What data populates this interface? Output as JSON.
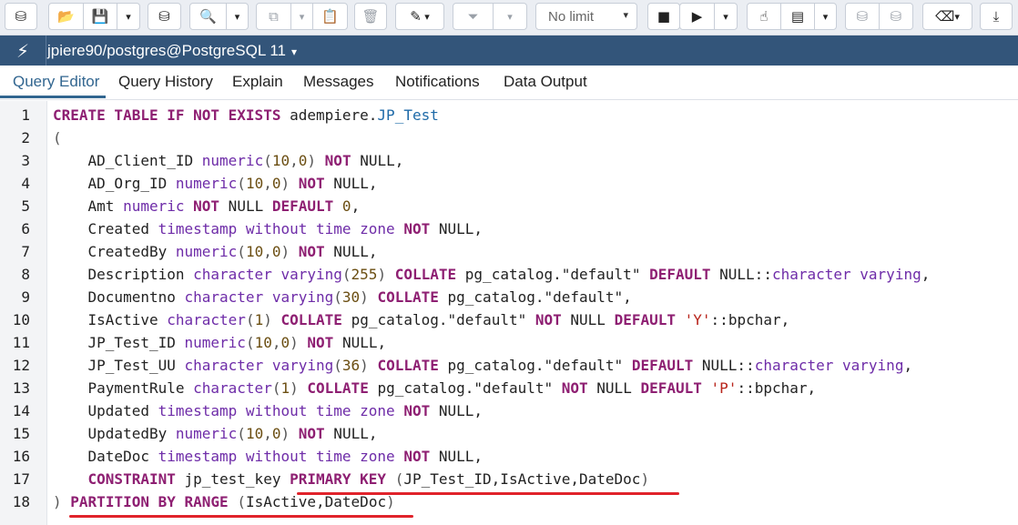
{
  "toolbar": {
    "limit": "No limit",
    "buttons": [
      {
        "name": "browser-icon",
        "glyph": "⛁"
      },
      {
        "name": "open-file-icon",
        "glyph": "📂"
      },
      {
        "name": "save-icon",
        "glyph": "💾"
      },
      {
        "name": "save-options-caret",
        "glyph": "▾"
      },
      {
        "name": "edit-db-icon",
        "glyph": "⛁"
      },
      {
        "name": "search-icon",
        "glyph": "🔍"
      },
      {
        "name": "search-caret",
        "glyph": "▾"
      },
      {
        "name": "copy-icon",
        "glyph": "⧉"
      },
      {
        "name": "copy-caret",
        "glyph": "▾"
      },
      {
        "name": "paste-icon",
        "glyph": "📋"
      },
      {
        "name": "delete-icon",
        "glyph": "🗑"
      },
      {
        "name": "edit-icon",
        "glyph": "✎"
      },
      {
        "name": "filter-icon",
        "glyph": "⏷"
      },
      {
        "name": "filter-caret",
        "glyph": "▾"
      },
      {
        "name": "stop-icon",
        "glyph": "■"
      },
      {
        "name": "execute-icon",
        "glyph": "▶"
      },
      {
        "name": "execute-caret",
        "glyph": "▾"
      },
      {
        "name": "explain-icon",
        "glyph": "☝"
      },
      {
        "name": "explain-analyze-icon",
        "glyph": "▤"
      },
      {
        "name": "explain-caret",
        "glyph": "▾"
      },
      {
        "name": "commit-icon",
        "glyph": "⛁"
      },
      {
        "name": "rollback-icon",
        "glyph": "⛁"
      },
      {
        "name": "clear-icon",
        "glyph": "⌫"
      },
      {
        "name": "clear-caret",
        "glyph": "▾"
      },
      {
        "name": "download-icon",
        "glyph": "⤓"
      }
    ]
  },
  "connection": {
    "label": "jpiere90/postgres@PostgreSQL 11",
    "icon": "plug-icon",
    "caret": "▾"
  },
  "tabs": [
    "Query Editor",
    "Query History",
    "Explain",
    "Messages",
    "Notifications",
    "Data Output"
  ],
  "colors": {
    "connbar": "#33557a",
    "active_tab": "#326690",
    "keyword": "#8e1f72",
    "type": "#6e2ca8",
    "number": "#6b4e12",
    "string": "#b8241b",
    "annotation": "#e0232b"
  },
  "editor": {
    "lines": [
      [
        [
          "kw",
          "CREATE TABLE IF NOT EXISTS"
        ],
        [
          "tx",
          " adempiere."
        ],
        [
          "ob",
          "JP_Test"
        ]
      ],
      [
        [
          "pn",
          "("
        ]
      ],
      [
        [
          "tx",
          "    AD_Client_ID "
        ],
        [
          "ty",
          "numeric"
        ],
        [
          "pn",
          "("
        ],
        [
          "nm",
          "10"
        ],
        [
          "pn",
          ","
        ],
        [
          "nm",
          "0"
        ],
        [
          "pn",
          ")"
        ],
        [
          "tx",
          " "
        ],
        [
          "kw",
          "NOT"
        ],
        [
          "tx",
          " NULL,"
        ]
      ],
      [
        [
          "tx",
          "    AD_Org_ID "
        ],
        [
          "ty",
          "numeric"
        ],
        [
          "pn",
          "("
        ],
        [
          "nm",
          "10"
        ],
        [
          "pn",
          ","
        ],
        [
          "nm",
          "0"
        ],
        [
          "pn",
          ")"
        ],
        [
          "tx",
          " "
        ],
        [
          "kw",
          "NOT"
        ],
        [
          "tx",
          " NULL,"
        ]
      ],
      [
        [
          "tx",
          "    Amt "
        ],
        [
          "ty",
          "numeric"
        ],
        [
          "tx",
          " "
        ],
        [
          "kw",
          "NOT"
        ],
        [
          "tx",
          " NULL "
        ],
        [
          "kw",
          "DEFAULT"
        ],
        [
          "tx",
          " "
        ],
        [
          "nm",
          "0"
        ],
        [
          "tx",
          ","
        ]
      ],
      [
        [
          "tx",
          "    Created "
        ],
        [
          "ty",
          "timestamp without time zone"
        ],
        [
          "tx",
          " "
        ],
        [
          "kw",
          "NOT"
        ],
        [
          "tx",
          " NULL,"
        ]
      ],
      [
        [
          "tx",
          "    CreatedBy "
        ],
        [
          "ty",
          "numeric"
        ],
        [
          "pn",
          "("
        ],
        [
          "nm",
          "10"
        ],
        [
          "pn",
          ","
        ],
        [
          "nm",
          "0"
        ],
        [
          "pn",
          ")"
        ],
        [
          "tx",
          " "
        ],
        [
          "kw",
          "NOT"
        ],
        [
          "tx",
          " NULL,"
        ]
      ],
      [
        [
          "tx",
          "    Description "
        ],
        [
          "ty",
          "character varying"
        ],
        [
          "pn",
          "("
        ],
        [
          "nm",
          "255"
        ],
        [
          "pn",
          ")"
        ],
        [
          "tx",
          " "
        ],
        [
          "kw",
          "COLLATE"
        ],
        [
          "tx",
          " pg_catalog.\"default\" "
        ],
        [
          "kw",
          "DEFAULT"
        ],
        [
          "tx",
          " NULL::"
        ],
        [
          "ty",
          "character varying"
        ],
        [
          "tx",
          ","
        ]
      ],
      [
        [
          "tx",
          "    Documentno "
        ],
        [
          "ty",
          "character varying"
        ],
        [
          "pn",
          "("
        ],
        [
          "nm",
          "30"
        ],
        [
          "pn",
          ")"
        ],
        [
          "tx",
          " "
        ],
        [
          "kw",
          "COLLATE"
        ],
        [
          "tx",
          " pg_catalog.\"default\","
        ]
      ],
      [
        [
          "tx",
          "    IsActive "
        ],
        [
          "ty",
          "character"
        ],
        [
          "pn",
          "("
        ],
        [
          "nm",
          "1"
        ],
        [
          "pn",
          ")"
        ],
        [
          "tx",
          " "
        ],
        [
          "kw",
          "COLLATE"
        ],
        [
          "tx",
          " pg_catalog.\"default\" "
        ],
        [
          "kw",
          "NOT"
        ],
        [
          "tx",
          " NULL "
        ],
        [
          "kw",
          "DEFAULT"
        ],
        [
          "tx",
          " "
        ],
        [
          "st",
          "'Y'"
        ],
        [
          "tx",
          "::bpchar,"
        ]
      ],
      [
        [
          "tx",
          "    JP_Test_ID "
        ],
        [
          "ty",
          "numeric"
        ],
        [
          "pn",
          "("
        ],
        [
          "nm",
          "10"
        ],
        [
          "pn",
          ","
        ],
        [
          "nm",
          "0"
        ],
        [
          "pn",
          ")"
        ],
        [
          "tx",
          " "
        ],
        [
          "kw",
          "NOT"
        ],
        [
          "tx",
          " NULL,"
        ]
      ],
      [
        [
          "tx",
          "    JP_Test_UU "
        ],
        [
          "ty",
          "character varying"
        ],
        [
          "pn",
          "("
        ],
        [
          "nm",
          "36"
        ],
        [
          "pn",
          ")"
        ],
        [
          "tx",
          " "
        ],
        [
          "kw",
          "COLLATE"
        ],
        [
          "tx",
          " pg_catalog.\"default\" "
        ],
        [
          "kw",
          "DEFAULT"
        ],
        [
          "tx",
          " NULL::"
        ],
        [
          "ty",
          "character varying"
        ],
        [
          "tx",
          ","
        ]
      ],
      [
        [
          "tx",
          "    PaymentRule "
        ],
        [
          "ty",
          "character"
        ],
        [
          "pn",
          "("
        ],
        [
          "nm",
          "1"
        ],
        [
          "pn",
          ")"
        ],
        [
          "tx",
          " "
        ],
        [
          "kw",
          "COLLATE"
        ],
        [
          "tx",
          " pg_catalog.\"default\" "
        ],
        [
          "kw",
          "NOT"
        ],
        [
          "tx",
          " NULL "
        ],
        [
          "kw",
          "DEFAULT"
        ],
        [
          "tx",
          " "
        ],
        [
          "st",
          "'P'"
        ],
        [
          "tx",
          "::bpchar,"
        ]
      ],
      [
        [
          "tx",
          "    Updated "
        ],
        [
          "ty",
          "timestamp without time zone"
        ],
        [
          "tx",
          " "
        ],
        [
          "kw",
          "NOT"
        ],
        [
          "tx",
          " NULL,"
        ]
      ],
      [
        [
          "tx",
          "    UpdatedBy "
        ],
        [
          "ty",
          "numeric"
        ],
        [
          "pn",
          "("
        ],
        [
          "nm",
          "10"
        ],
        [
          "pn",
          ","
        ],
        [
          "nm",
          "0"
        ],
        [
          "pn",
          ")"
        ],
        [
          "tx",
          " "
        ],
        [
          "kw",
          "NOT"
        ],
        [
          "tx",
          " NULL,"
        ]
      ],
      [
        [
          "tx",
          "    DateDoc "
        ],
        [
          "ty",
          "timestamp without time zone"
        ],
        [
          "tx",
          " "
        ],
        [
          "kw",
          "NOT"
        ],
        [
          "tx",
          " NULL,"
        ]
      ],
      [
        [
          "tx",
          "    "
        ],
        [
          "kw",
          "CONSTRAINT"
        ],
        [
          "tx",
          " jp_test_key "
        ],
        [
          "kw",
          "PRIMARY KEY"
        ],
        [
          "tx",
          " "
        ],
        [
          "pn",
          "("
        ],
        [
          "tx",
          "JP_Test_ID,IsActive,DateDoc"
        ],
        [
          "pn",
          ")"
        ]
      ],
      [
        [
          "pn",
          ")"
        ],
        [
          "tx",
          " "
        ],
        [
          "kw",
          "PARTITION BY RANGE"
        ],
        [
          "tx",
          " "
        ],
        [
          "pn",
          "("
        ],
        [
          "tx",
          "IsActive,DateDoc"
        ],
        [
          "pn",
          ")"
        ]
      ]
    ]
  }
}
